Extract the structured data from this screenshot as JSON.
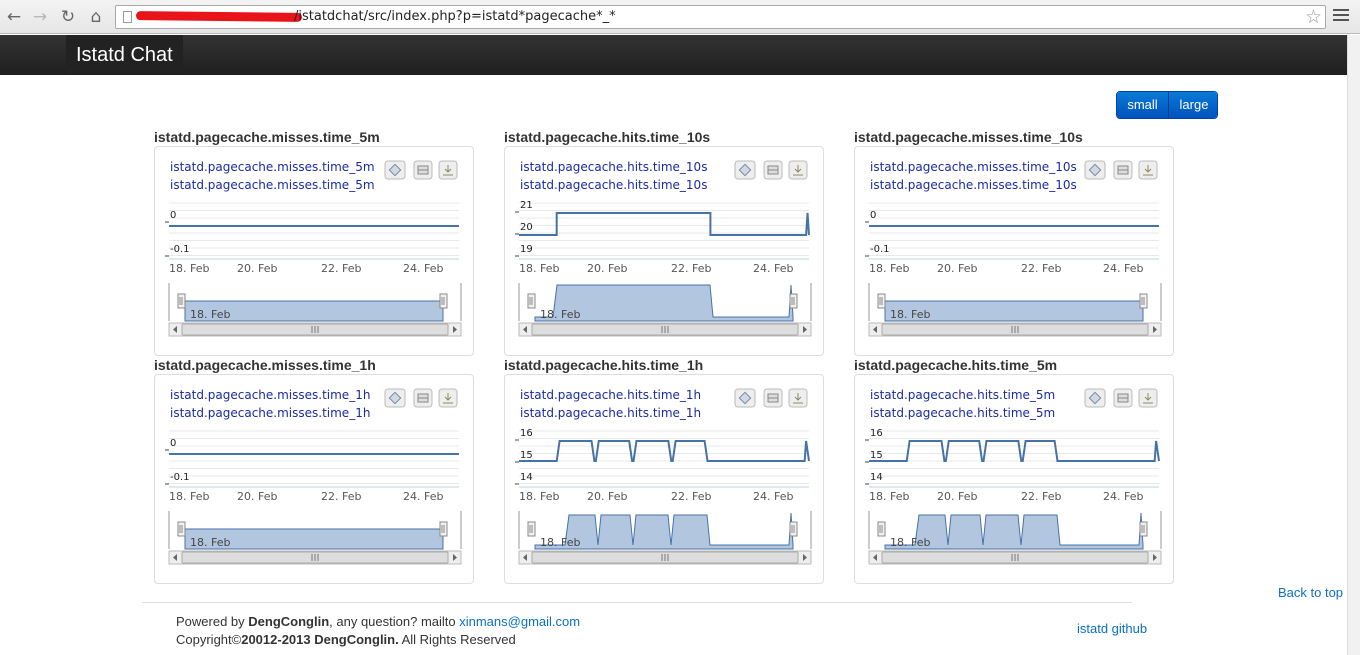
{
  "browser": {
    "url": "/istatdchat/src/index.php?p=istatd*pagecache*_*",
    "back_icon": "back-arrow-icon",
    "forward_icon": "forward-arrow-icon",
    "reload_icon": "reload-icon",
    "home_icon": "home-icon"
  },
  "navbar": {
    "brand": "Istatd Chat"
  },
  "size_toggle": {
    "small": "small",
    "large": "large"
  },
  "charts": [
    {
      "title": "istatd.pagecache.misses.time_5m",
      "legend": "istatd.pagecache.misses.time_5m",
      "y_ticks": [
        "0",
        "-0.1"
      ],
      "x_ticks": [
        "18. Feb",
        "20. Feb",
        "22. Feb",
        "24. Feb"
      ],
      "navigator_label": "18. Feb",
      "chart_data": {
        "type": "line",
        "x": [
          "18. Feb",
          "20. Feb",
          "22. Feb",
          "24. Feb"
        ],
        "y_range": [
          -0.1,
          0
        ],
        "series": [
          {
            "values": [
              0,
              0,
              0,
              0
            ]
          }
        ]
      }
    },
    {
      "title": "istatd.pagecache.hits.time_10s",
      "legend": "istatd.pagecache.hits.time_10s",
      "y_ticks": [
        "21",
        "20",
        "19"
      ],
      "x_ticks": [
        "18. Feb",
        "20. Feb",
        "22. Feb",
        "24. Feb"
      ],
      "navigator_label": "18. Feb",
      "chart_data": {
        "type": "line",
        "x": [
          "18. Feb",
          "20. Feb",
          "22. Feb",
          "24. Feb"
        ],
        "y_range": [
          19,
          21
        ],
        "series": [
          {
            "values": [
              20,
              21,
              21,
              20
            ]
          }
        ]
      }
    },
    {
      "title": "istatd.pagecache.misses.time_10s",
      "legend": "istatd.pagecache.misses.time_10s",
      "y_ticks": [
        "0",
        "-0.1"
      ],
      "x_ticks": [
        "18. Feb",
        "20. Feb",
        "22. Feb",
        "24. Feb"
      ],
      "navigator_label": "18. Feb",
      "chart_data": {
        "type": "line",
        "x": [
          "18. Feb",
          "20. Feb",
          "22. Feb",
          "24. Feb"
        ],
        "y_range": [
          -0.1,
          0
        ],
        "series": [
          {
            "values": [
              0,
              0,
              0,
              0
            ]
          }
        ]
      }
    },
    {
      "title": "istatd.pagecache.misses.time_1h",
      "legend": "istatd.pagecache.misses.time_1h",
      "y_ticks": [
        "0",
        "-0.1"
      ],
      "x_ticks": [
        "18. Feb",
        "20. Feb",
        "22. Feb",
        "24. Feb"
      ],
      "navigator_label": "18. Feb",
      "chart_data": {
        "type": "line",
        "x": [
          "18. Feb",
          "20. Feb",
          "22. Feb",
          "24. Feb"
        ],
        "y_range": [
          -0.1,
          0
        ],
        "series": [
          {
            "values": [
              0,
              0,
              0,
              0
            ]
          }
        ]
      }
    },
    {
      "title": "istatd.pagecache.hits.time_1h",
      "legend": "istatd.pagecache.hits.time_1h",
      "y_ticks": [
        "16",
        "15",
        "14"
      ],
      "x_ticks": [
        "18. Feb",
        "20. Feb",
        "22. Feb",
        "24. Feb"
      ],
      "navigator_label": "18. Feb",
      "chart_data": {
        "type": "line",
        "x": [
          "18. Feb",
          "20. Feb",
          "22. Feb",
          "24. Feb"
        ],
        "y_range": [
          14,
          16
        ],
        "series": [
          {
            "values": [
              15,
              16,
              16,
              15
            ]
          }
        ]
      }
    },
    {
      "title": "istatd.pagecache.hits.time_5m",
      "legend": "istatd.pagecache.hits.time_5m",
      "y_ticks": [
        "16",
        "15",
        "14"
      ],
      "x_ticks": [
        "18. Feb",
        "20. Feb",
        "22. Feb",
        "24. Feb"
      ],
      "navigator_label": "18. Feb",
      "chart_data": {
        "type": "line",
        "x": [
          "18. Feb",
          "20. Feb",
          "22. Feb",
          "24. Feb"
        ],
        "y_range": [
          14,
          16
        ],
        "series": [
          {
            "values": [
              15,
              16,
              16,
              15
            ]
          }
        ]
      }
    }
  ],
  "footer": {
    "powered_prefix": "Powered by ",
    "author": "DengConglin",
    "question_text": ", any question? mailto ",
    "email": "xinmans@gmail.com",
    "copyright_prefix": "Copyright©",
    "copyright_bold": "20012-2013 DengConglin.",
    "copyright_suffix": " All Rights Reserved",
    "github": "istatd github",
    "back_to_top": "Back to top"
  },
  "colors": {
    "series": "#4572a7",
    "navigator_fill": "#b3c6e0",
    "navbar": "#222222",
    "button": "#0060c8"
  }
}
